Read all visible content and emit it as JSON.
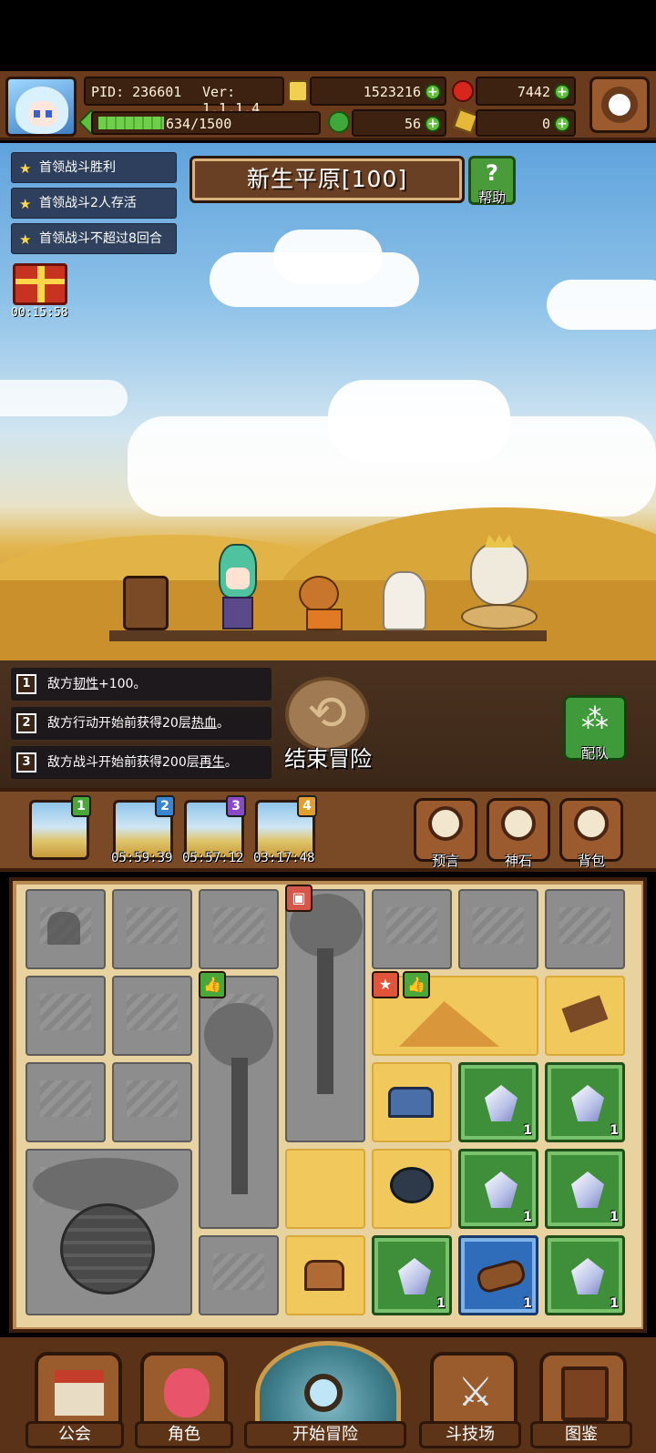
{
  "hud": {
    "pid": "PID: 236601",
    "version": "Ver: 1.1.1.4",
    "gold": "1523216",
    "gems": "7442",
    "exp": "634/1500",
    "clover": "56",
    "key": "0"
  },
  "quests": [
    "首领战斗胜利",
    "首领战斗2人存活",
    "首领战斗不超过8回合"
  ],
  "gift_timer": "00:15:58",
  "stage": {
    "title": "新生平原[100]",
    "help_label": "帮助"
  },
  "effects": [
    {
      "num": "1",
      "prefix": "敌方",
      "keyword": "韧性",
      "suffix": "+100。"
    },
    {
      "num": "2",
      "prefix": "敌方行动开始前获得20层",
      "keyword": "热血",
      "suffix": "。"
    },
    {
      "num": "3",
      "prefix": "敌方战斗开始前获得200层",
      "keyword": "再生",
      "suffix": "。"
    }
  ],
  "actions": {
    "end_adventure": "结束冒险",
    "team": "配队"
  },
  "cards": [
    {
      "badge": "1",
      "timer": ""
    },
    {
      "badge": "2",
      "timer": "05:59:39"
    },
    {
      "badge": "3",
      "timer": "05:57:12"
    },
    {
      "badge": "4",
      "timer": "03:17:48"
    }
  ],
  "tools": [
    "预言",
    "神石",
    "背包"
  ],
  "map": {
    "crystal_count": "1",
    "log_count": "1"
  },
  "nav": [
    "公会",
    "角色",
    "开始冒险",
    "斗技场",
    "图鉴"
  ],
  "colors": {
    "accent_brown": "#6b3b1e",
    "tile_green": "#3f8f3a",
    "tile_blue": "#2f6dba",
    "tile_sand": "#f0c85c"
  }
}
